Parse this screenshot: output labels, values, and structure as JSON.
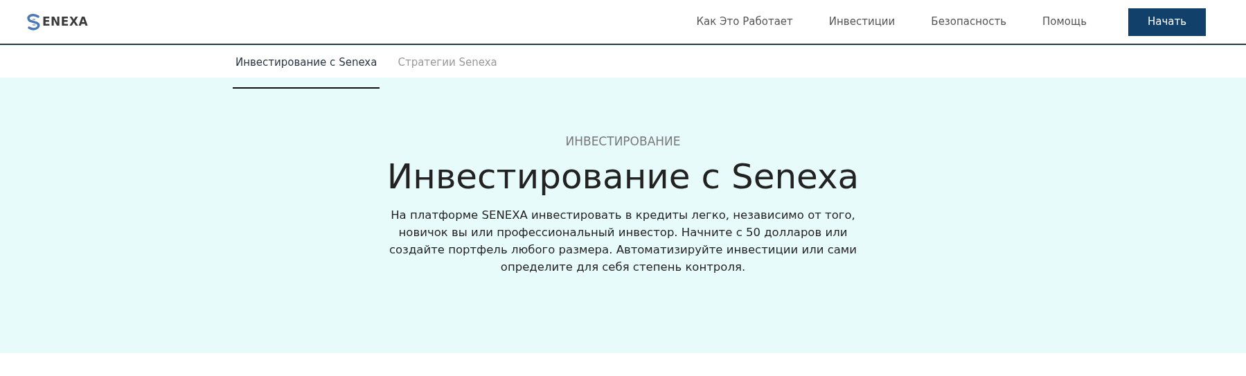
{
  "header": {
    "logo": "ENEXA",
    "nav": [
      "Как Это Работает",
      "Инвестиции",
      "Безопасность",
      "Помощь"
    ],
    "cta": "Начать"
  },
  "tabs": [
    {
      "label": "Инвестирование с Senexa",
      "selected": true
    },
    {
      "label": "Стратегии Senexa",
      "selected": false
    }
  ],
  "hero": {
    "eyebrow": "ИНВЕСТИРОВАНИЕ",
    "title": "Инвестирование с Senexa",
    "text": "На платформе SENEXA инвестировать в кредиты легко, независимо от того, новичок вы или профессиональный инвестор. Начните с 50 долларов или создайте портфель любого размера. Автоматизируйте инвестиции или сами определите для себя степень контроля."
  }
}
